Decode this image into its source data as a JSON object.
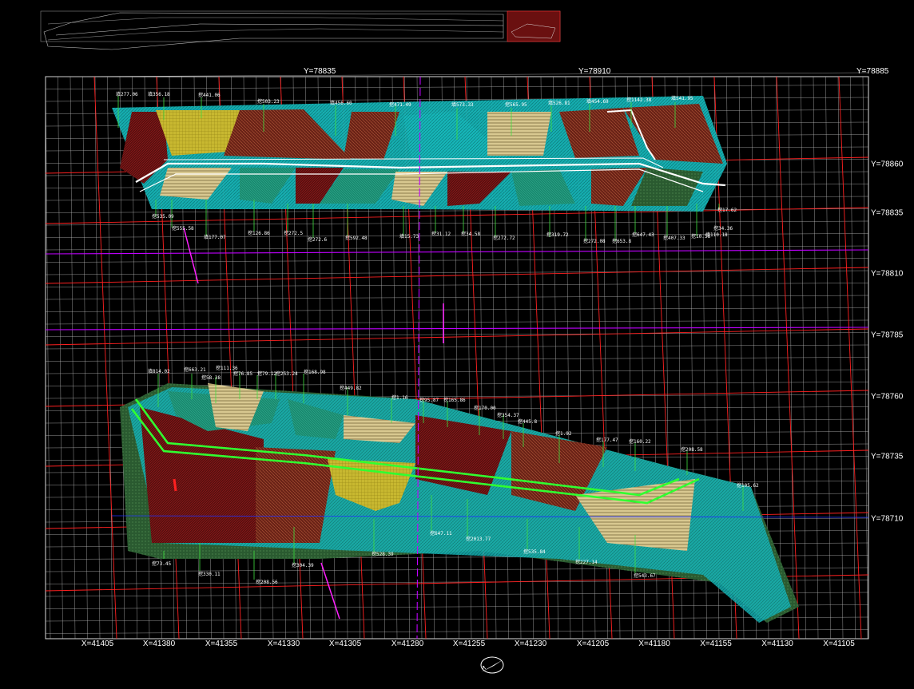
{
  "drawing": {
    "x_axis_labels": [
      "X=41405",
      "X=41380",
      "X=41355",
      "X=41330",
      "X=41305",
      "X=41280",
      "X=41255",
      "X=41230",
      "X=41205",
      "X=41180",
      "X=41155",
      "X=41130",
      "X=41105"
    ],
    "y_axis_labels": [
      "Y=78860",
      "Y=78835",
      "Y=78810",
      "Y=78785",
      "Y=78760",
      "Y=78735",
      "Y=78710"
    ],
    "top_y_labels": [
      "Y=78835",
      "Y=78910",
      "Y=78885"
    ],
    "colors": {
      "background": "#000000",
      "grid_red": "#ff2020",
      "grid_white": "#cfcfcf",
      "axis_magenta": "#c000ff",
      "fill_cyan": "#16b6b8",
      "fill_brown": "#7a2a1a",
      "fill_yellow": "#d8d040",
      "fill_green": "#2e6a3a",
      "road_green": "#30ff30",
      "leader_green": "#40e040"
    },
    "upper_annotations": [
      "填277.06",
      "填356.18",
      "挖441.06",
      "挖503.23",
      "填456.60",
      "挖471.49",
      "填573.33",
      "挖565.95",
      "填526.81",
      "填454.69",
      "挖1142.38",
      "填541.95",
      "挖535.09",
      "挖555.58",
      "填177.07",
      "挖126.86",
      "挖272.5",
      "挖272.6",
      "挖592.48",
      "填15.73",
      "挖31.12",
      "挖34.58",
      "挖272.72",
      "挖319.72",
      "挖272.08",
      "挖653.8",
      "挖647.43",
      "挖407.33",
      "挖10.58",
      "填110.18",
      "挖34.36",
      "挖17.62"
    ],
    "lower_annotations": [
      "填814.02",
      "挖663.21",
      "挖58.38",
      "挖111.36",
      "挖76.85",
      "挖79.12",
      "挖253.24",
      "挖168.98",
      "挖449.82",
      "挖1.16",
      "挖95.87",
      "挖165.86",
      "挖170.00",
      "挖354.37",
      "挖445.8",
      "挖1.92",
      "挖177.47",
      "挖160.22",
      "挖208.58",
      "挖105.62",
      "挖73.45",
      "挖330.11",
      "挖208.56",
      "挖304.39",
      "挖528.39",
      "挖647.11",
      "挖2013.77",
      "挖535.84",
      "挖227.14",
      "挖543.67"
    ]
  }
}
